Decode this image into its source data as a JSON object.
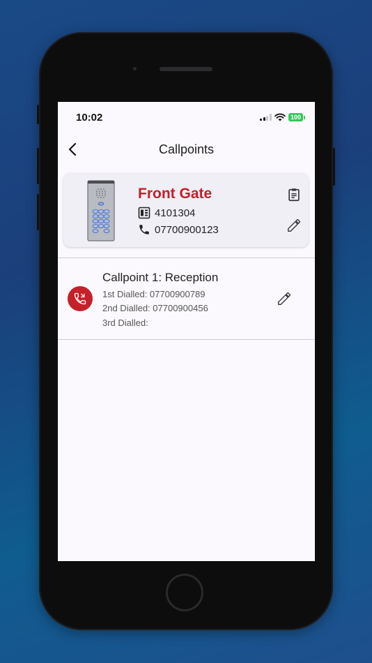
{
  "status_bar": {
    "time": "10:02",
    "battery": "100"
  },
  "header": {
    "title": "Callpoints"
  },
  "device": {
    "name": "Front Gate",
    "id": "4101304",
    "phone": "07700900123"
  },
  "callpoints": [
    {
      "title": "Callpoint 1: Reception",
      "line1": "1st Dialled: 07700900789",
      "line2": "2nd Dialled: 07700900456",
      "line3": "3rd Dialled:"
    }
  ],
  "colors": {
    "accent": "#c2202a",
    "battery": "#34c759"
  },
  "icons": [
    "chevron-left-icon",
    "clipboard-icon",
    "pencil-icon",
    "keypad-id-icon",
    "phone-icon",
    "phone-callback-icon"
  ]
}
